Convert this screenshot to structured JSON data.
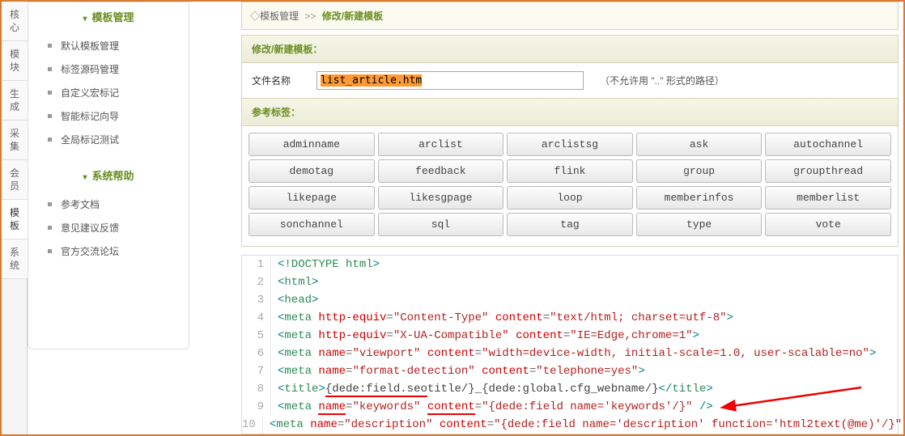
{
  "leftTabs": [
    "核心",
    "模块",
    "生成",
    "采集",
    "会员",
    "模板",
    "系统"
  ],
  "activeLeftTab": 5,
  "sidebar": {
    "sections": [
      {
        "title": "模板管理",
        "items": [
          "默认模板管理",
          "标签源码管理",
          "自定义宏标记",
          "智能标记向导",
          "全局标记测试"
        ]
      },
      {
        "title": "系统帮助",
        "items": [
          "参考文档",
          "意见建议反馈",
          "官方交流论坛"
        ]
      }
    ]
  },
  "breadcrumb": {
    "a": "模板管理",
    "b": "修改/新建模板"
  },
  "panel": {
    "header": "修改/新建模板："
  },
  "form": {
    "label": "文件名称",
    "value": "list_article.htm",
    "hint": "（不允许用 \"..\" 形式的路径）"
  },
  "tags": {
    "header": "参考标签：",
    "rows": [
      [
        "adminname",
        "arclist",
        "arclistsg",
        "ask",
        "autochannel"
      ],
      [
        "demotag",
        "feedback",
        "flink",
        "group",
        "groupthread"
      ],
      [
        "likepage",
        "likesgpage",
        "loop",
        "memberinfos",
        "memberlist"
      ],
      [
        "sonchannel",
        "sql",
        "tag",
        "type",
        "vote"
      ]
    ]
  },
  "code": {
    "lines": [
      {
        "n": 1,
        "raw": "<!DOCTYPE html>"
      },
      {
        "n": 2,
        "raw": "<html>"
      },
      {
        "n": 3,
        "raw": "<head>"
      },
      {
        "n": 4,
        "tag": "meta",
        "attrs": [
          [
            "http-equiv",
            "Content-Type"
          ],
          [
            "content",
            "text/html; charset=utf-8"
          ]
        ]
      },
      {
        "n": 5,
        "tag": "meta",
        "attrs": [
          [
            "http-equiv",
            "X-UA-Compatible"
          ],
          [
            "content",
            "IE=Edge,chrome=1"
          ]
        ]
      },
      {
        "n": 6,
        "tag": "meta",
        "attrs": [
          [
            "name",
            "viewport"
          ],
          [
            "content",
            "width=device-width, initial-scale=1.0, user-scalable=no"
          ]
        ]
      },
      {
        "n": 7,
        "tag": "meta",
        "attrs": [
          [
            "name",
            "format-detection"
          ],
          [
            "content",
            "telephone=yes"
          ]
        ]
      },
      {
        "n": 8,
        "title": true,
        "t1": "{dede:field.seo",
        "t2": "title/}",
        "mid": "_",
        "t3": "{dede:global.cfg_webname/}"
      },
      {
        "n": 9,
        "tag": "meta",
        "attrs": [
          [
            "name",
            "keywords"
          ],
          [
            "content",
            "{dede:field name='keywords'/}"
          ]
        ],
        "self": true,
        "ul": true
      },
      {
        "n": 10,
        "tag": "meta",
        "attrs": [
          [
            "name",
            "description"
          ],
          [
            "content",
            "{dede:field name='description' function='html2text(@me)'/}"
          ]
        ],
        "self": true
      }
    ]
  }
}
